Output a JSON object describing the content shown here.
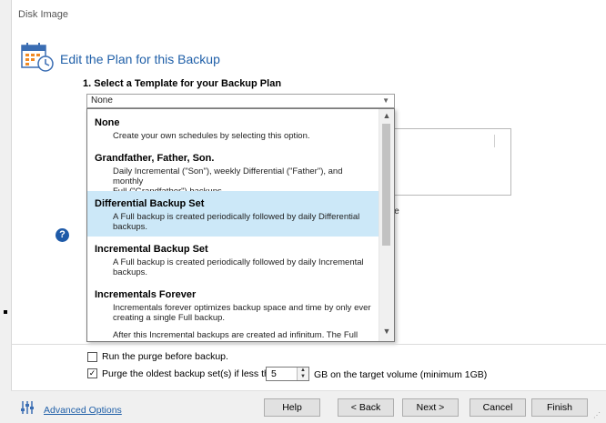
{
  "window": {
    "title": "Disk Image"
  },
  "header": {
    "title": "Edit the Plan for this Backup",
    "icon": "calendar-clock-icon"
  },
  "step": {
    "label": "1. Select a Template for your Backup Plan"
  },
  "template_combo": {
    "value": "None"
  },
  "background": {
    "partial_text": "le"
  },
  "dropdown": {
    "options": [
      {
        "title": "None",
        "description": "Create your own schedules by selecting this option.",
        "selected": false
      },
      {
        "title": "Grandfather, Father, Son.",
        "description_lines": [
          "Daily Incremental (\"Son\"), weekly Differential (\"Father\"), and monthly",
          "Full (\"Grandfather\") backups."
        ],
        "selected": false
      },
      {
        "title": "Differential Backup Set",
        "description_lines": [
          "A Full backup is created periodically followed by daily Differential",
          "backups."
        ],
        "selected": true
      },
      {
        "title": "Incremental Backup Set",
        "description_lines": [
          "A Full backup is created periodically followed by daily Incremental",
          "backups."
        ],
        "selected": false
      },
      {
        "title": "Incrementals Forever",
        "description_lines": [
          "Incrementals forever optimizes backup space and time by only ever",
          "creating a single Full backup."
        ],
        "extra_line": "After this Incremental backups are created ad infinitum. The Full",
        "selected": false
      }
    ]
  },
  "purge": {
    "run_before_label": "Run the purge before backup.",
    "run_before_checked": false,
    "oldest_label": "Purge the oldest backup set(s) if less than",
    "oldest_checked": true,
    "gb_value": "5",
    "gb_suffix": "GB on the target volume (minimum 1GB)"
  },
  "footer": {
    "advanced_label": "Advanced Options",
    "buttons": {
      "help": "Help",
      "back": "< Back",
      "next": "Next >",
      "cancel": "Cancel",
      "finish": "Finish"
    }
  },
  "colors": {
    "accent": "#1f5fa8",
    "selection": "#cce8f8"
  }
}
